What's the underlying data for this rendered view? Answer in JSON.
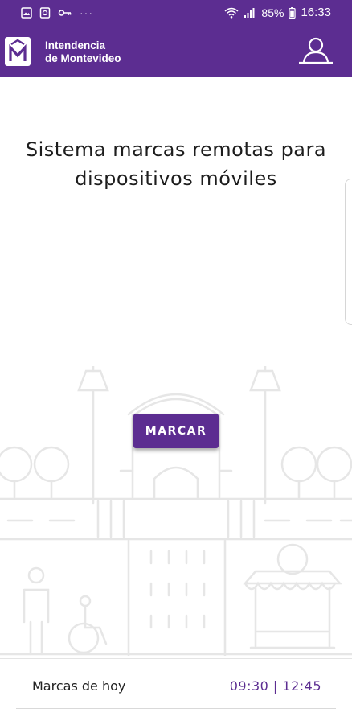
{
  "status_bar": {
    "battery": "85%",
    "time": "16:33",
    "left_icons": [
      "gallery-icon",
      "screenshot-icon",
      "key-icon",
      "more-dots-icon"
    ],
    "more_dots": "···"
  },
  "app_bar": {
    "brand_line1": "Intendencia",
    "brand_line2": "de Montevideo",
    "logo_letter": "M",
    "brand_color": "#5c2d91"
  },
  "main": {
    "title": "Sistema marcas remotas para dispositivos móviles",
    "marcar_button": "MARCAR"
  },
  "footer": {
    "label": "Marcas de hoy",
    "times": "09:30 | 12:45"
  }
}
